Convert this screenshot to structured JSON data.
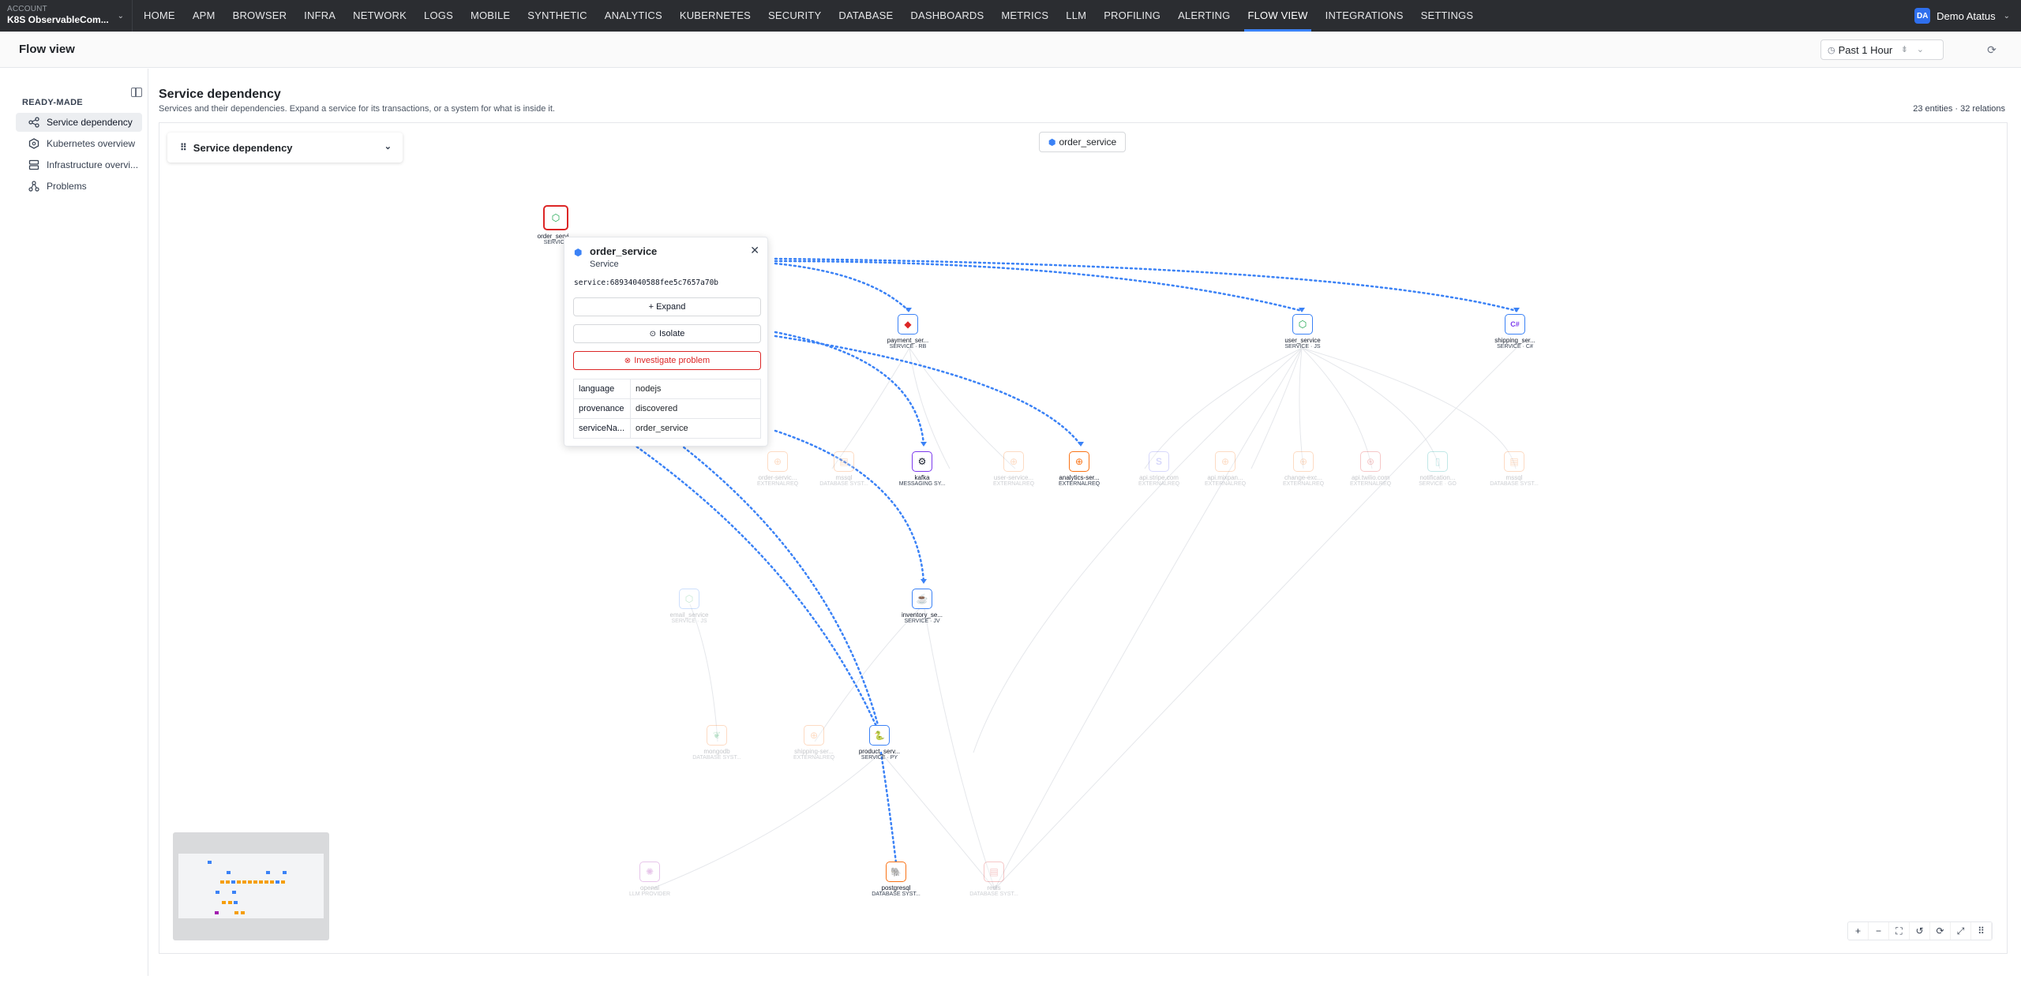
{
  "account": {
    "label": "ACCOUNT",
    "name": "K8S ObservableCom..."
  },
  "nav": [
    "HOME",
    "APM",
    "BROWSER",
    "INFRA",
    "NETWORK",
    "LOGS",
    "MOBILE",
    "SYNTHETIC",
    "ANALYTICS",
    "KUBERNETES",
    "SECURITY",
    "DATABASE",
    "DASHBOARDS",
    "METRICS",
    "LLM",
    "PROFILING",
    "ALERTING",
    "FLOW VIEW",
    "INTEGRATIONS",
    "SETTINGS"
  ],
  "nav_active": "FLOW VIEW",
  "user": {
    "initials": "DA",
    "name": "Demo Atatus"
  },
  "page": {
    "title": "Flow view",
    "time_range": "Past 1 Hour"
  },
  "sidebar": {
    "section": "READY-MADE",
    "items": [
      {
        "label": "Service dependency",
        "icon": "share-icon"
      },
      {
        "label": "Kubernetes overview",
        "icon": "kubernetes-icon"
      },
      {
        "label": "Infrastructure overvi...",
        "icon": "server-icon"
      },
      {
        "label": "Problems",
        "icon": "problems-icon"
      }
    ]
  },
  "main": {
    "title": "Service dependency",
    "description": "Services and their dependencies. Expand a service for its transactions, or a system for what is inside it.",
    "counts": "23 entities · 32 relations",
    "view_select": "Service dependency",
    "focus": "order_service"
  },
  "nodes": [
    {
      "name": "order_servi...",
      "type": "SERVICE",
      "glyph": "⬡",
      "color": "#16a34a"
    },
    {
      "name": "payment_ser...",
      "type": "SERVICE · RB",
      "glyph": "◆",
      "color": "#dc2626"
    },
    {
      "name": "user_service",
      "type": "SERVICE · JS",
      "glyph": "⬡",
      "color": "#16a34a"
    },
    {
      "name": "shipping_ser...",
      "type": "SERVICE · C#",
      "glyph": "C#",
      "color": "#7c3aed"
    },
    {
      "name": "kafka",
      "type": "MESSAGING SY...",
      "glyph": "⚙",
      "color": "#111827"
    },
    {
      "name": "analytics-ser...",
      "type": "EXTERNALREQ",
      "glyph": "⊕",
      "color": "#f97316"
    },
    {
      "name": "inventory_se...",
      "type": "SERVICE · JV",
      "glyph": "☕",
      "color": "#2563eb"
    },
    {
      "name": "product_serv...",
      "type": "SERVICE · PY",
      "glyph": "🐍",
      "color": "#2563eb"
    },
    {
      "name": "postgresql",
      "type": "DATABASE SYST...",
      "glyph": "🐘",
      "color": "#336791"
    },
    {
      "name": "order-servic...",
      "type": "EXTERNALREQ",
      "glyph": "⊕",
      "color": "#f97316"
    },
    {
      "name": "mssql",
      "type": "DATABASE SYST...",
      "glyph": "▤",
      "color": "#f97316"
    },
    {
      "name": "user-service...",
      "type": "EXTERNALREQ",
      "glyph": "⊕",
      "color": "#f97316"
    },
    {
      "name": "api.stripe.com",
      "type": "EXTERNALREQ",
      "glyph": "S",
      "color": "#6366f1"
    },
    {
      "name": "api.mixpan...",
      "type": "EXTERNALREQ",
      "glyph": "⊕",
      "color": "#f97316"
    },
    {
      "name": "change-exc...",
      "type": "EXTERNALREQ",
      "glyph": "⊕",
      "color": "#f97316"
    },
    {
      "name": "api.twilio.com",
      "type": "EXTERNALREQ",
      "glyph": "⊛",
      "color": "#dc2626"
    },
    {
      "name": "notification...",
      "type": "SERVICE · GO",
      "glyph": "▯",
      "color": "#0ea5a4"
    },
    {
      "name": "mssql",
      "type": "DATABASE SYST...",
      "glyph": "▤",
      "color": "#f97316"
    },
    {
      "name": "email_service",
      "type": "SERVICE · JS",
      "glyph": "⬡",
      "color": "#16a34a"
    },
    {
      "name": "mongodb",
      "type": "DATABASE SYST...",
      "glyph": "❦",
      "color": "#16a34a"
    },
    {
      "name": "shipping-ser...",
      "type": "EXTERNALREQ",
      "glyph": "⊕",
      "color": "#f97316"
    },
    {
      "name": "openai",
      "type": "LLM PROVIDER",
      "glyph": "✺",
      "color": "#a21caf"
    },
    {
      "name": "redis",
      "type": "DATABASE SYST...",
      "glyph": "▤",
      "color": "#dc2626"
    }
  ],
  "popup": {
    "title": "order_service",
    "subtitle": "Service",
    "service_id": "service:68934040588fee5c7657a70b",
    "buttons": {
      "expand": "+ Expand",
      "isolate": "Isolate",
      "investigate": "Investigate problem"
    },
    "props": [
      {
        "key": "language",
        "value": "nodejs"
      },
      {
        "key": "provenance",
        "value": "discovered"
      },
      {
        "key": "serviceNa...",
        "value": "order_service"
      }
    ]
  },
  "colors": {
    "accent": "#3b82f6",
    "danger": "#dc2626",
    "nav_bg": "#2b2d31"
  }
}
